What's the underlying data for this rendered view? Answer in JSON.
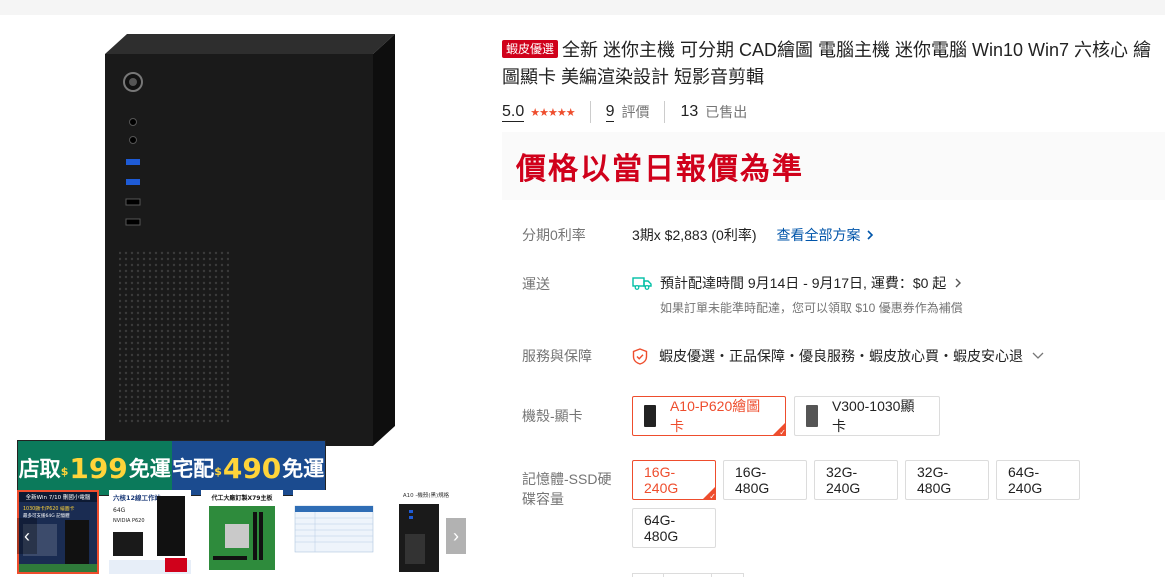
{
  "product": {
    "badge": "蝦皮優選",
    "title": "全新 迷你主機 可分期 CAD繪圖 電腦主機 迷你電腦 Win10 Win7 六核心 繪圖顯卡 美編渲染設計 短影音剪輯",
    "rating": "5.0",
    "stars": "★★★★★",
    "review_count": "9",
    "review_label": "評價",
    "sold_count": "13",
    "sold_label": "已售出",
    "price_text": "價格以當日報價為準"
  },
  "promo": {
    "store_pickup_label": "店取",
    "store_pickup_price": "199",
    "store_pickup_suffix": "免運",
    "home_delivery_label": "宅配",
    "home_delivery_price": "490",
    "home_delivery_suffix": "免運",
    "currency": "$"
  },
  "installment": {
    "label": "分期0利率",
    "value": "3期x $2,883 (0利率)",
    "link": "查看全部方案"
  },
  "shipping": {
    "label": "運送",
    "line": "預計配達時間 9月14日 - 9月17日, 運費：$0 起",
    "note": "如果訂單未能準時配達，您可以領取 $10 優惠券作為補償"
  },
  "service": {
    "label": "服務與保障",
    "text": "蝦皮優選・正品保障・優良服務・蝦皮放心買・蝦皮安心退"
  },
  "variation_case": {
    "label": "機殼-顯卡",
    "options": [
      "A10-P620繪圖卡",
      "V300-1030顯卡"
    ]
  },
  "variation_memory": {
    "label_line1": "記憶體-SSD硬",
    "label_line2": "碟容量",
    "options": [
      "16G-240G",
      "16G-480G",
      "32G-240G",
      "32G-480G",
      "64G-240G",
      "64G-480G"
    ]
  },
  "thumbnails": {
    "t1_text_a": "全新Win 7/10 刪國小電腦",
    "t1_text_b": "1030顯卡/P620 繪圖卡",
    "t1_text_c": "最多可支援64G 記憶體",
    "t2_text_a": "六核12線工作站",
    "t2_text_b": "64G",
    "t2_text_c": "NVIDIA P620",
    "t3_text_a": "代工大廠訂製X79主板",
    "t5_text_a": "A10 -機殼(黑)規格"
  },
  "colors": {
    "accent": "#ee4d2d",
    "price_red": "#d0011b",
    "link_blue": "#0055aa",
    "promo_green": "#0b7a5b",
    "promo_blue": "#1b4b8f"
  }
}
